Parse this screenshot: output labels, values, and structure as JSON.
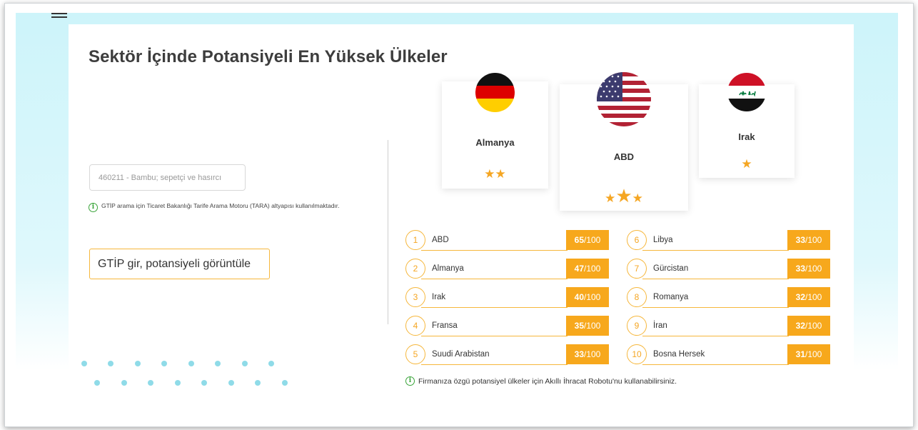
{
  "page": {
    "title": "Sektör İçinde Potansiyeli En Yüksek Ülkeler"
  },
  "search": {
    "placeholder": "460211 - Bambu; sepetçi ve hasırcı",
    "info_text": "GTİP arama için Ticaret Bakanlığı Tarife Arama Motoru (TARA) altyapısı kullanılmaktadır.",
    "button_label": "GTİP gir, potansiyeli görüntüle"
  },
  "podium": [
    {
      "name": "Almanya",
      "stars": 2,
      "flag_icon": "germany-flag-icon"
    },
    {
      "name": "ABD",
      "stars": 3,
      "flag_icon": "usa-flag-icon"
    },
    {
      "name": "Irak",
      "stars": 1,
      "flag_icon": "iraq-flag-icon"
    }
  ],
  "ranking": [
    {
      "rank": "1",
      "country": "ABD",
      "score": "65",
      "max": "/100"
    },
    {
      "rank": "2",
      "country": "Almanya",
      "score": "47",
      "max": "/100"
    },
    {
      "rank": "3",
      "country": "Irak",
      "score": "40",
      "max": "/100"
    },
    {
      "rank": "4",
      "country": "Fransa",
      "score": "35",
      "max": "/100"
    },
    {
      "rank": "5",
      "country": "Suudi Arabistan",
      "score": "33",
      "max": "/100"
    },
    {
      "rank": "6",
      "country": "Libya",
      "score": "33",
      "max": "/100"
    },
    {
      "rank": "7",
      "country": "Gürcistan",
      "score": "33",
      "max": "/100"
    },
    {
      "rank": "8",
      "country": "Romanya",
      "score": "32",
      "max": "/100"
    },
    {
      "rank": "9",
      "country": "İran",
      "score": "32",
      "max": "/100"
    },
    {
      "rank": "10",
      "country": "Bosna Hersek",
      "score": "31",
      "max": "/100"
    }
  ],
  "footer_note": "Firmanıza özgü potansiyel ülkeler için Akıllı İhracat Robotu'nu kullanabilirsiniz.",
  "colors": {
    "accent": "#f7a81c",
    "info_green": "#3aa43a",
    "band": "#cdf4fa"
  }
}
